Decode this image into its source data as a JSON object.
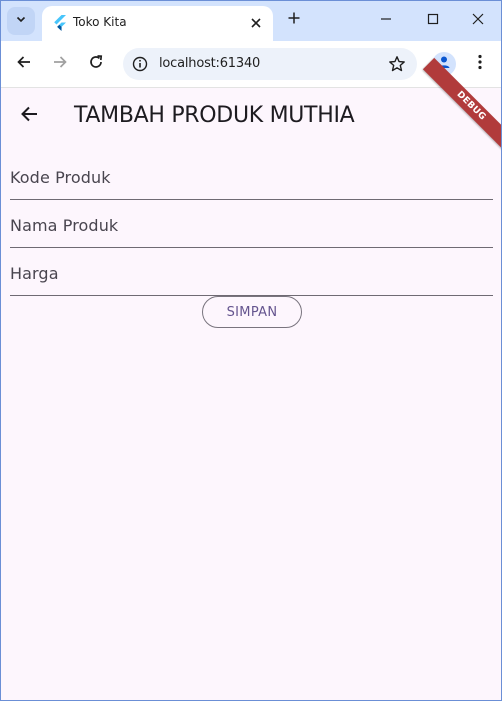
{
  "browser": {
    "tab_title": "Toko Kita",
    "url": "localhost:61340",
    "icons": {
      "tab_search": "chevron-down-icon",
      "favicon": "flutter-icon",
      "tab_close": "close-icon",
      "new_tab": "plus-icon",
      "minimize": "minimize-icon",
      "maximize": "maximize-icon",
      "close_window": "close-icon",
      "back": "arrow-left-icon",
      "forward": "arrow-right-icon",
      "reload": "reload-icon",
      "site_info": "info-icon",
      "bookmark": "star-icon",
      "profile": "person-icon",
      "menu": "more-vert-icon"
    }
  },
  "app": {
    "title": "TAMBAH PRODUK MUTHIA",
    "debug_banner": "DEBUG",
    "fields": [
      {
        "label": "Kode Produk",
        "value": ""
      },
      {
        "label": "Nama Produk",
        "value": ""
      },
      {
        "label": "Harga",
        "value": ""
      }
    ],
    "submit_label": "SIMPAN",
    "colors": {
      "background": "#fdf6fd",
      "button_text": "#65558f",
      "debug_banner": "#b13b3b",
      "tab_strip": "#d3e3fd"
    }
  }
}
